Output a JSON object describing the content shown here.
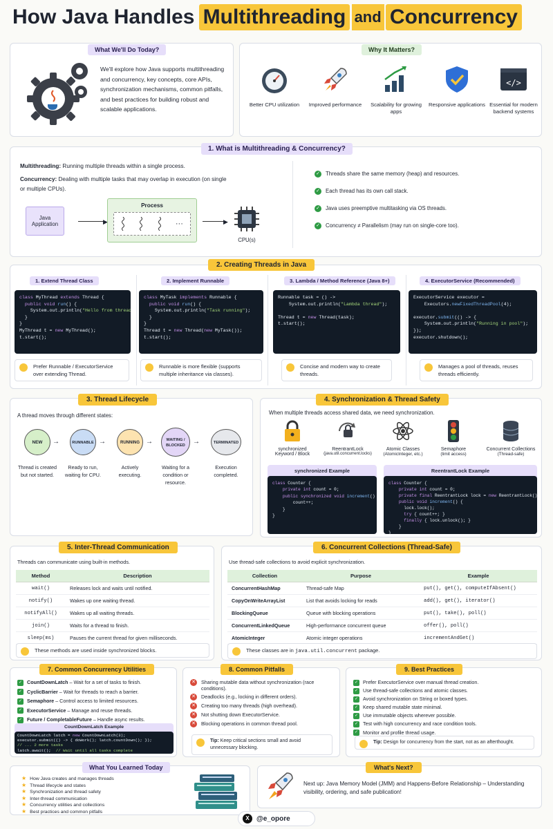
{
  "header": {
    "title_plain": "How Java Handles",
    "title_highlight_1": "Multithreading",
    "title_and": "and",
    "title_highlight_2": "Concurrency"
  },
  "today": {
    "tag": "What We'll Do Today?",
    "text": "We'll explore how Java supports multithreading and concurrency, key concepts, core APIs, synchronization mechanisms, common pitfalls, and best practices for building robust and scalable applications."
  },
  "why": {
    "tag": "Why It Matters?",
    "items": [
      {
        "icon": "gauge-icon",
        "label": "Better CPU utilization"
      },
      {
        "icon": "rocket-icon",
        "label": "Improved performance"
      },
      {
        "icon": "bar-chart-icon",
        "label": "Scalability for growing apps"
      },
      {
        "icon": "shield-check-icon",
        "label": "Responsive applications"
      },
      {
        "icon": "code-window-icon",
        "label": "Essential for modern backend systems"
      }
    ]
  },
  "s1": {
    "tag": "1. What is Multithreading & Concurrency?",
    "mt_label": "Multithreading:",
    "mt_text": "Running multiple threads within a single process.",
    "cc_label": "Concurrency:",
    "cc_text": "Dealing with multiple tasks that may overlap in execution (on single or multiple CPUs).",
    "app": "Java Application",
    "process": "Process",
    "dots": "···",
    "cpu": "CPU(s)",
    "checks": [
      "Threads share the same memory (heap) and resources.",
      "Each thread has its own call stack.",
      "Java uses preemptive multitasking via OS threads.",
      "Concurrency ≠ Parallelism (may run on single-core too)."
    ]
  },
  "s2": {
    "tag": "2. Creating Threads in Java",
    "cols": [
      {
        "tag": "1. Extend Thread Class",
        "tip": "Prefer Runnable / ExecutorService over extending Thread."
      },
      {
        "tag": "2. Implement Runnable",
        "tip": "Runnable is more flexible (supports multiple inheritance via classes)."
      },
      {
        "tag": "3. Lambda / Method Reference (Java 8+)",
        "tip": "Concise and modern way to create threads."
      },
      {
        "tag": "4. ExecutorService (Recommended)",
        "tip": "Manages a pool of threads, reuses threads efficiently."
      }
    ]
  },
  "s3": {
    "tag": "3. Thread Lifecycle",
    "intro": "A thread moves through different states:",
    "states": [
      {
        "name": "NEW",
        "desc": "Thread is created but not started.",
        "color": "#d6efc9"
      },
      {
        "name": "RUNNABLE",
        "desc": "Ready to run, waiting for CPU.",
        "color": "#c9dcf5"
      },
      {
        "name": "RUNNING",
        "desc": "Actively executing.",
        "color": "#fde3b0"
      },
      {
        "name": "WAITING / BLOCKED",
        "desc": "Waiting for a condition or resource.",
        "color": "#e3d6f7"
      },
      {
        "name": "TERMINATED",
        "desc": "Execution completed.",
        "color": "#e6e8ec"
      }
    ]
  },
  "s4": {
    "tag": "4. Synchronization & Thread Safety",
    "intro": "When multiple threads access shared data, we need synchronization.",
    "items": [
      {
        "icon": "padlock-icon",
        "name": "synchronized",
        "sub": "Keyword / Block"
      },
      {
        "icon": "reentrant-lock-icon",
        "name": "ReentrantLock",
        "sub": "(java.util.concurrent.locks)"
      },
      {
        "icon": "atom-icon",
        "name": "Atomic Classes",
        "sub": "(AtomicInteger, etc.)"
      },
      {
        "icon": "traffic-light-icon",
        "name": "Semaphore",
        "sub": "(limit access)"
      },
      {
        "icon": "database-icon",
        "name": "Concurrent Collections",
        "sub": "(Thread-safe)"
      }
    ],
    "ex1": "synchronized Example",
    "ex2": "ReentrantLock Example"
  },
  "s5": {
    "tag": "5. Inter-Thread Communication",
    "intro": "Threads can communicate using built-in methods.",
    "headers": [
      "Method",
      "Description"
    ],
    "rows": [
      [
        "wait()",
        "Releases lock and waits until notified."
      ],
      [
        "notify()",
        "Wakes up one waiting thread."
      ],
      [
        "notifyAll()",
        "Wakes up all waiting threads."
      ],
      [
        "join()",
        "Waits for a thread to finish."
      ],
      [
        "sleep(ms)",
        "Pauses the current thread for given milliseconds."
      ]
    ],
    "tip": "These methods are used inside synchronized blocks."
  },
  "s6": {
    "tag": "6. Concurrent Collections (Thread-Safe)",
    "intro": "Use thread-safe collections to avoid explicit synchronization.",
    "headers": [
      "Collection",
      "Purpose",
      "Example"
    ],
    "rows": [
      [
        "ConcurrentHashMap",
        "Thread-safe Map",
        "put(), get(), computeIfAbsent()"
      ],
      [
        "CopyOnWriteArrayList",
        "List that avoids locking for reads",
        "add(), get(), iterator()"
      ],
      [
        "BlockingQueue",
        "Queue with blocking operations",
        "put(), take(), poll()"
      ],
      [
        "ConcurrentLinkedQueue",
        "High-performance concurrent queue",
        "offer(), poll()"
      ],
      [
        "AtomicInteger",
        "Atomic integer operations",
        "incrementAndGet()"
      ]
    ],
    "tip_pre": "These classes are in",
    "tip_code": "java.util.concurrent",
    "tip_post": "package."
  },
  "s7": {
    "tag": "7. Common Concurrency Utilities",
    "items": [
      {
        "name": "CountDownLatch",
        "desc": "– Wait for a set of tasks to finish."
      },
      {
        "name": "CyclicBarrier",
        "desc": "– Wait for threads to reach a barrier."
      },
      {
        "name": "Semaphore",
        "desc": "– Control access to limited resources."
      },
      {
        "name": "ExecutorService",
        "desc": "– Manage and reuse threads."
      },
      {
        "name": "Future / CompletableFuture",
        "desc": "– Handle async results."
      }
    ],
    "ex": "CountDownLatch Example"
  },
  "s8": {
    "tag": "8. Common Pitfalls",
    "items": [
      "Sharing mutable data without synchronization (race conditions).",
      "Deadlocks (e.g., locking in different orders).",
      "Creating too many threads (high overhead).",
      "Not shutting down ExecutorService.",
      "Blocking operations in common thread pool."
    ],
    "tip_label": "Tip:",
    "tip": "Keep critical sections small and avoid unnecessary blocking."
  },
  "s9": {
    "tag": "9. Best Practices",
    "items": [
      "Prefer ExecutorService over manual thread creation.",
      "Use thread-safe collections and atomic classes.",
      "Avoid synchronization on String or boxed types.",
      "Keep shared mutable state minimal.",
      "Use immutable objects wherever possible.",
      "Test with high concurrency and race condition tools.",
      "Monitor and profile thread usage."
    ],
    "tip_label": "Tip:",
    "tip": "Design for concurrency from the start, not as an afterthought."
  },
  "learned": {
    "tag": "What You Learned Today",
    "items": [
      "How Java creates and manages threads",
      "Thread lifecycle and states",
      "Synchronization and thread safety",
      "Inter-thread communication",
      "Concurrency utilities and collections",
      "Best practices and common pitfalls"
    ]
  },
  "next": {
    "tag": "What's Next?",
    "label": "Next up:",
    "text": "Java Memory Model (JMM) and Happens-Before Relationship – Understanding visibility, ordering, and safe publication!"
  },
  "footer": {
    "handle": "@e_opore",
    "icon": "x-logo-icon"
  },
  "colors": {
    "accent_yellow": "#f8c63a",
    "purple_tag": "#e6defa",
    "green_tag": "#dff1dc",
    "code_bg": "#121b26"
  }
}
